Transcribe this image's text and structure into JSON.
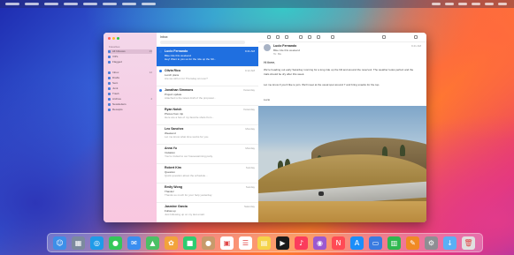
{
  "mail": {
    "sidebar": {
      "favorites_label": "Favorites",
      "items": [
        {
          "label": "All Inboxes",
          "count": "26"
        },
        {
          "label": "VIPs",
          "count": ""
        },
        {
          "label": "Flagged",
          "count": ""
        },
        {
          "label": "Inbox",
          "count": "12"
        },
        {
          "label": "Drafts",
          "count": ""
        },
        {
          "label": "Sent",
          "count": ""
        },
        {
          "label": "Junk",
          "count": ""
        },
        {
          "label": "Trash",
          "count": ""
        },
        {
          "label": "Archive",
          "count": "4"
        },
        {
          "label": "Newsletters",
          "count": ""
        },
        {
          "label": "Receipts",
          "count": ""
        }
      ]
    },
    "list": {
      "header": "Inbox",
      "messages": [
        {
          "from": "Lucio Fernando",
          "time": "9:41 AM",
          "subject": "Bike ride this weekend",
          "preview": "Hey! Want to join us for the ride up the hill..."
        },
        {
          "from": "Olivia Rico",
          "time": "9:12 AM",
          "subject": "Lunch plans",
          "preview": "Are we still on for Thursday at noon?"
        },
        {
          "from": "Jonathan Simmons",
          "time": "Yesterday",
          "subject": "Project update",
          "preview": "Attached is the latest draft of the proposal..."
        },
        {
          "from": "Ryan Notch",
          "time": "Yesterday",
          "subject": "Photos from trip",
          "preview": "Here are a few of my favorite shots from..."
        },
        {
          "from": "Leo Sanchez",
          "time": "Monday",
          "subject": "Weekend",
          "preview": "Let me know what time works for you."
        },
        {
          "from": "Anna Yu",
          "time": "Monday",
          "subject": "Invitation",
          "preview": "You're invited to our housewarming party."
        },
        {
          "from": "Robert Kim",
          "time": "Sunday",
          "subject": "Question",
          "preview": "Quick question about the schedule..."
        },
        {
          "from": "Emily Wong",
          "time": "Sunday",
          "subject": "Thanks!",
          "preview": "Thanks so much for your help yesterday."
        },
        {
          "from": "Jasmine Garcia",
          "time": "Saturday",
          "subject": "Follow up",
          "preview": "Just following up on my last email."
        }
      ]
    },
    "reader": {
      "from": "Lucio Fernando",
      "subject": "Bike ride this weekend",
      "to": "To: Me",
      "date": "9:41 AM",
      "greeting": "Hi there,",
      "body1": "We're heading out early Saturday morning for a long ride up the hill and around the reservoir. The weather looks perfect and the trails should be dry after this week.",
      "body2": "Let me know if you'd like to join. We'll meet at the usual spot around 7 and bring snacks for the top.",
      "sign": "Lucio"
    }
  },
  "dock": {
    "icons": [
      "finder-icon",
      "launchpad-icon",
      "safari-icon",
      "messages-icon",
      "mail-icon",
      "maps-icon",
      "photos-icon",
      "facetime-icon",
      "contacts-icon",
      "calendar-icon",
      "reminders-icon",
      "notes-icon",
      "tv-icon",
      "music-icon",
      "podcasts-icon",
      "news-icon",
      "app-store-icon",
      "keynote-icon",
      "numbers-icon",
      "pages-icon",
      "system-preferences-icon",
      "downloads-icon",
      "trash-icon"
    ]
  }
}
